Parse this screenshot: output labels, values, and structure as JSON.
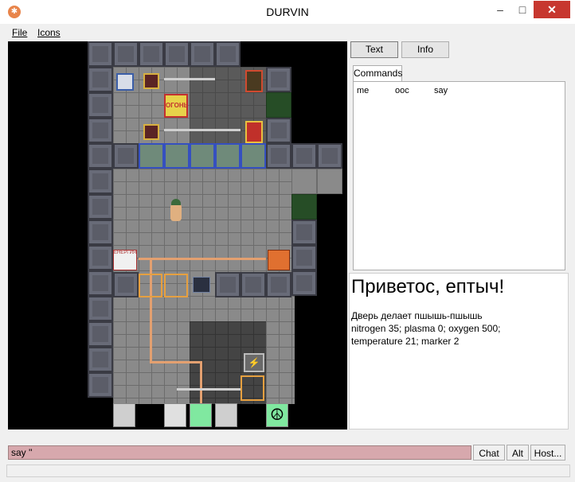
{
  "window": {
    "title": "DURVIN",
    "min_glyph": "–",
    "max_glyph": "□",
    "close_glyph": "✕"
  },
  "menu": {
    "file": "File",
    "icons": "Icons"
  },
  "tabs": {
    "text": "Text",
    "info": "Info"
  },
  "commands_tab": "Commands",
  "commands": [
    "me",
    "ooc",
    "say"
  ],
  "info": {
    "title": "Приветос, ептыч!",
    "lines": [
      "Дверь делает пшышь-пшышь",
      "nitrogen 35; plasma 0; oxygen 500;",
      "temperature 21; marker 2"
    ]
  },
  "map_labels": {
    "sign": "ОГОНЬ",
    "power": "ЕНЕРГИЯ"
  },
  "input": {
    "value": "say ''"
  },
  "buttons": {
    "chat": "Chat",
    "alt": "Alt",
    "host": "Host..."
  },
  "colors": {
    "input_bg": "#d7a8ad",
    "close_btn": "#c7372f"
  }
}
